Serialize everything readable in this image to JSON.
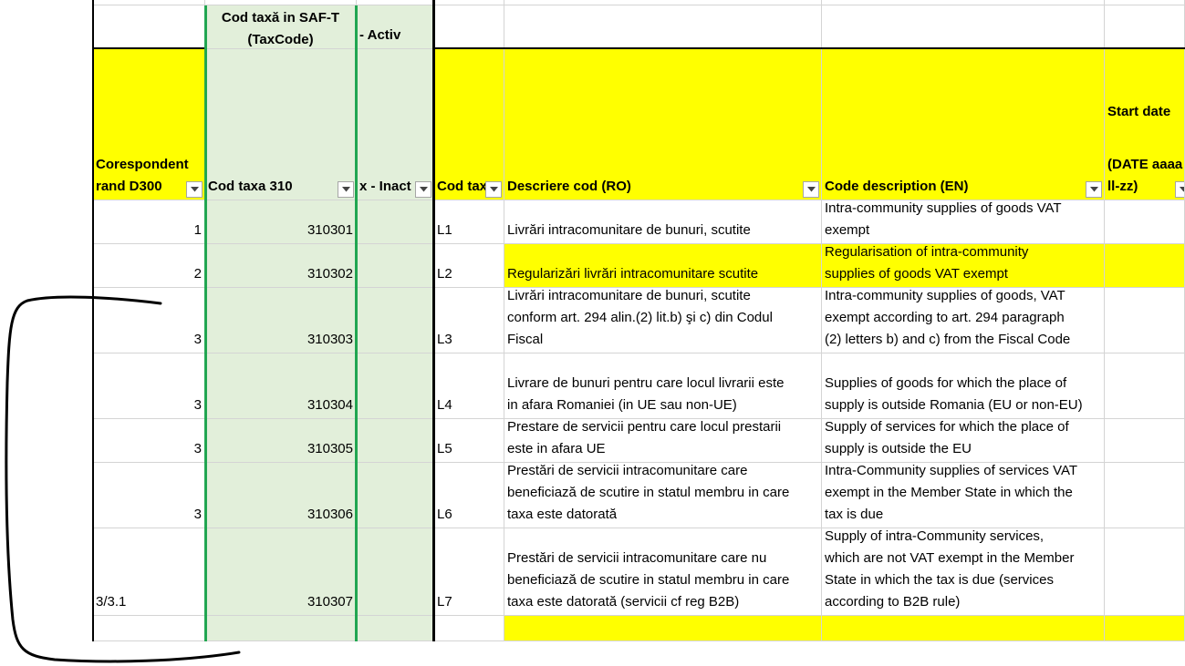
{
  "header_top": {
    "col2_line1": "Cod taxă in SAF-T",
    "col2_line2": "(TaxCode)",
    "col3": "- Activ"
  },
  "header": {
    "col1": "Corespondent\nrand D300",
    "col2": "Cod taxa 310",
    "col3": "x - Inact",
    "col4": "Cod tax",
    "col5": "Descriere cod (RO)",
    "col6": "Code description (EN)",
    "col7_line1": "Start date",
    "col7_line2": "(DATE aaaa\nll-zz)"
  },
  "rows": [
    {
      "d300": "1",
      "code": "310301",
      "tax": "L1",
      "ro": "Livrări intracomunitare de bunuri, scutite",
      "en": "Intra-community supplies of goods VAT\nexempt",
      "highlight": false
    },
    {
      "d300": "2",
      "code": "310302",
      "tax": "L2",
      "ro": "Regularizări livrări intracomunitare scutite",
      "en": "Regularisation of intra-community\nsupplies of goods VAT exempt",
      "highlight": true
    },
    {
      "d300": "3",
      "code": "310303",
      "tax": "L3",
      "ro": "Livrări intracomunitare de bunuri, scutite\nconform art. 294 alin.(2) lit.b) şi c) din Codul\nFiscal",
      "en": "Intra-community supplies of goods, VAT\nexempt according to art. 294 paragraph\n(2) letters b) and c) from the Fiscal Code",
      "highlight": false
    },
    {
      "d300": "3",
      "code": "310304",
      "tax": "L4",
      "ro": "Livrare de bunuri pentru care locul livrarii este\nin afara Romaniei (in UE sau non-UE)",
      "en": "Supplies of goods for which the place of\nsupply is outside Romania (EU or non-EU)",
      "highlight": false
    },
    {
      "d300": "3",
      "code": "310305",
      "tax": "L5",
      "ro": "Prestare de servicii pentru care locul prestarii\neste in afara UE",
      "en": "Supply of services for which the place of\nsupply is outside the EU",
      "highlight": false
    },
    {
      "d300": "3",
      "code": "310306",
      "tax": "L6",
      "ro": "Prestări de servicii intracomunitare care\nbeneficiază de scutire in statul membru in care\ntaxa este datorată",
      "en": "Intra-Community supplies of services VAT\nexempt in the Member State in which the\ntax is due",
      "highlight": false
    },
    {
      "d300": "3/3.1",
      "code": "310307",
      "tax": "L7",
      "ro": "Prestări de servicii intracomunitare care nu\nbeneficiază de scutire in statul membru in care\ntaxa este datorată (servicii cf reg B2B)",
      "en": "Supply of intra-Community services,\nwhich are not VAT exempt in the Member\nState in which the tax is due (services\naccording to B2B rule)",
      "highlight": false
    }
  ],
  "icons": {
    "filter": "dropdown-arrow-icon",
    "annotation": "pen-bracket-scribble"
  },
  "colors": {
    "header_yellow": "#ffff00",
    "column_green": "#e2efda",
    "border_green": "#21a651"
  }
}
